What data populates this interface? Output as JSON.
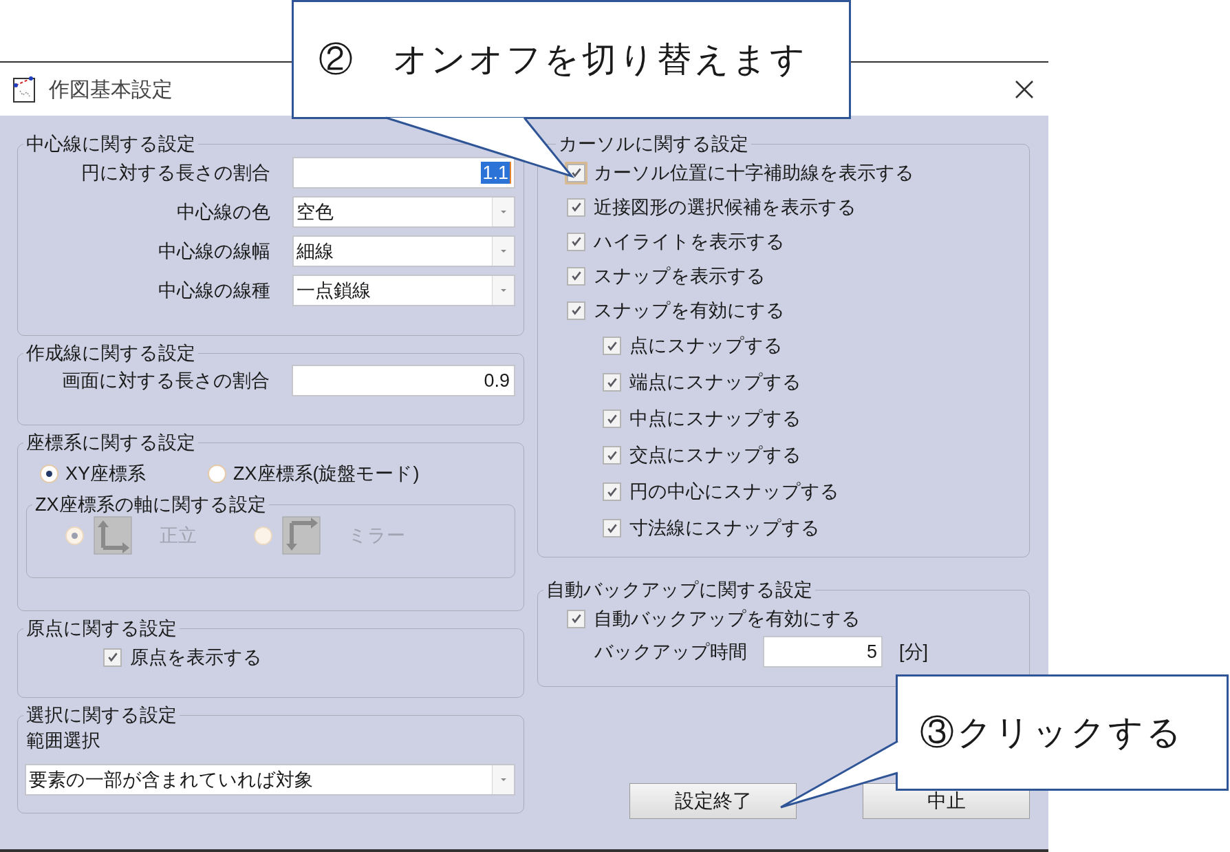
{
  "window": {
    "title": "作図基本設定"
  },
  "centerline": {
    "title": "中心線に関する設定",
    "fields": [
      {
        "kind": "text",
        "label": "円に対する長さの割合",
        "value": "1.1",
        "highlighted": true
      },
      {
        "kind": "dropdown",
        "label": "中心線の色",
        "value": "空色"
      },
      {
        "kind": "dropdown",
        "label": "中心線の線幅",
        "value": "細線"
      },
      {
        "kind": "dropdown",
        "label": "中心線の線種",
        "value": "一点鎖線"
      }
    ]
  },
  "construction_line": {
    "title": "作成線に関する設定",
    "fields": [
      {
        "kind": "text",
        "label": "画面に対する長さの割合",
        "value": "0.9",
        "highlighted": false
      }
    ]
  },
  "coordinate_system": {
    "title": "座標系に関する設定",
    "options": [
      {
        "label": "XY座標系",
        "selected": true
      },
      {
        "label": "ZX座標系(旋盤モード)",
        "selected": false
      }
    ],
    "axis_settings": {
      "title": "ZX座標系の軸に関する設定",
      "disabled": true,
      "options": [
        {
          "kind": "upright",
          "label": "正立",
          "selected": true
        },
        {
          "kind": "mirror",
          "label": "ミラー",
          "selected": false
        }
      ]
    }
  },
  "origin": {
    "title": "原点に関する設定",
    "checkboxes": [
      {
        "label": "原点を表示する",
        "checked": true,
        "focused": false
      }
    ]
  },
  "selection": {
    "title": "選択に関する設定",
    "label": "範囲選択",
    "value": "要素の一部が含まれていれば対象"
  },
  "cursor": {
    "title": "カーソルに関する設定",
    "checkboxes": [
      {
        "label": "カーソル位置に十字補助線を表示する",
        "checked": true,
        "focused": true
      },
      {
        "label": "近接図形の選択候補を表示する",
        "checked": true,
        "focused": false
      },
      {
        "label": "ハイライトを表示する",
        "checked": true,
        "focused": false
      },
      {
        "label": "スナップを表示する",
        "checked": true,
        "focused": false
      },
      {
        "label": "スナップを有効にする",
        "checked": true,
        "focused": false,
        "children": [
          {
            "label": "点にスナップする",
            "checked": true,
            "focused": false
          },
          {
            "label": "端点にスナップする",
            "checked": true,
            "focused": false
          },
          {
            "label": "中点にスナップする",
            "checked": true,
            "focused": false
          },
          {
            "label": "交点にスナップする",
            "checked": true,
            "focused": false
          },
          {
            "label": "円の中心にスナップする",
            "checked": true,
            "focused": false
          },
          {
            "label": "寸法線にスナップする",
            "checked": true,
            "focused": false
          }
        ]
      }
    ]
  },
  "auto_backup": {
    "title": "自動バックアップに関する設定",
    "checkboxes": [
      {
        "label": "自動バックアップを有効にする",
        "checked": true,
        "focused": false
      }
    ],
    "interval": {
      "label": "バックアップ時間",
      "value": "5",
      "unit": "[分]"
    }
  },
  "buttons": [
    {
      "label": "設定終了"
    },
    {
      "label": "中止"
    }
  ],
  "callouts": [
    {
      "text": "②　オンオフを切り替えます"
    },
    {
      "text": "③クリックする"
    }
  ]
}
